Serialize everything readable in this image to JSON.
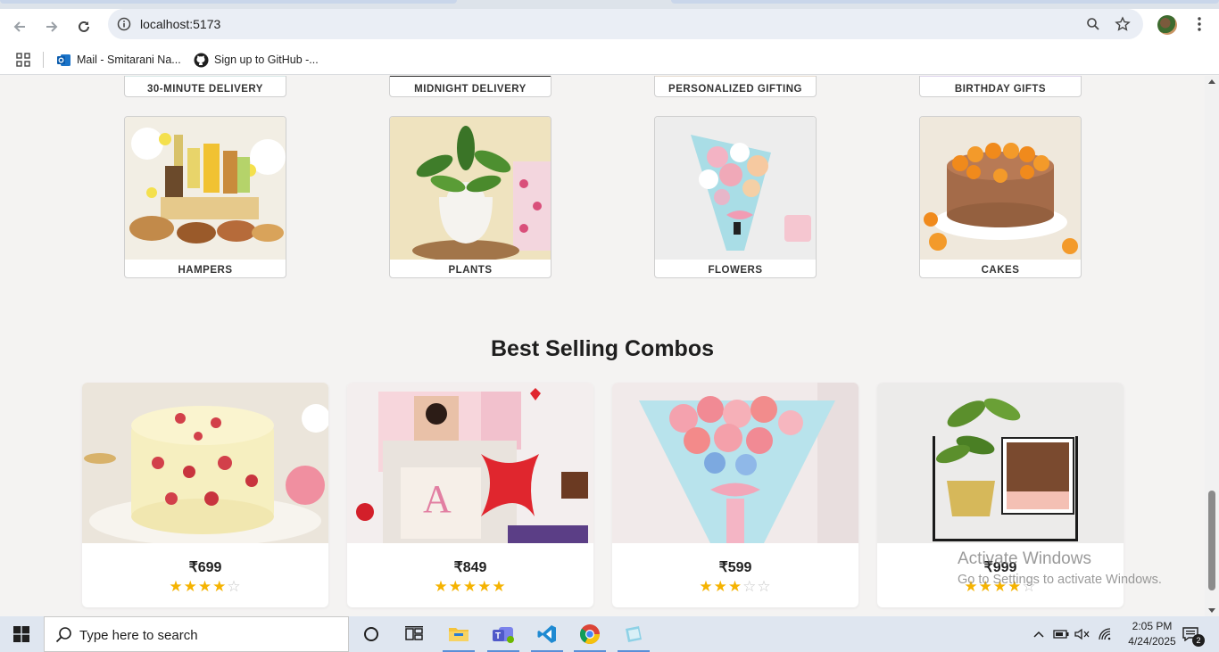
{
  "browser": {
    "url": "localhost:5173",
    "bookmarks": [
      {
        "label": "Mail - Smitarani Na..."
      },
      {
        "label": "Sign up to GitHub -..."
      }
    ]
  },
  "categories_top_row": [
    {
      "label": "30-MINUTE DELIVERY"
    },
    {
      "label": "MIDNIGHT DELIVERY"
    },
    {
      "label": "PERSONALIZED GIFTING"
    },
    {
      "label": "BIRTHDAY GIFTS"
    }
  ],
  "categories": [
    {
      "label": "HAMPERS",
      "image": "gift-hamper-basket"
    },
    {
      "label": "PLANTS",
      "image": "potted-plant-buddha"
    },
    {
      "label": "FLOWERS",
      "image": "flower-bouquet"
    },
    {
      "label": "CAKES",
      "image": "orange-chocolate-cake"
    }
  ],
  "best_selling": {
    "title": "Best Selling Combos",
    "items": [
      {
        "price": "₹699",
        "rating": 4,
        "image": "heart-cake"
      },
      {
        "price": "₹849",
        "rating": 5,
        "image": "personalized-gift-box"
      },
      {
        "price": "₹599",
        "rating": 3,
        "image": "pink-rose-bouquet"
      },
      {
        "price": "₹999",
        "rating": 4,
        "image": "plant-with-photo-frame"
      }
    ]
  },
  "watermark": {
    "line1": "Activate Windows",
    "line2": "Go to Settings to activate Windows."
  },
  "taskbar": {
    "search_placeholder": "Type here to search",
    "time": "2:05 PM",
    "date": "4/24/2025",
    "notification_count": "2"
  },
  "colors": {
    "star": "#f5b301",
    "page_bg": "#f4f3f2",
    "taskbar_bg": "#dfe6f0"
  }
}
